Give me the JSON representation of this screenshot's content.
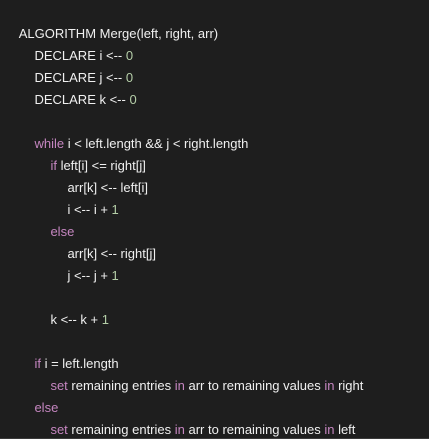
{
  "code": {
    "header": {
      "text": "ALGORITHM Merge(left, right, arr)"
    },
    "decl_i": {
      "kw": "DECLARE i <-- ",
      "val": "0"
    },
    "decl_j": {
      "kw": "DECLARE j <-- ",
      "val": "0"
    },
    "decl_k": {
      "kw": "DECLARE k <-- ",
      "val": "0"
    },
    "while_line": {
      "kw": "while",
      "rest": " i < left.length && j < right.length"
    },
    "if_line": {
      "kw": "if",
      "rest": " left[i] <= right[j]"
    },
    "assign_left": {
      "text": "arr[k] <-- left[i]"
    },
    "inc_i": {
      "text": "i <-- i + ",
      "val": "1"
    },
    "else_line": {
      "kw": "else"
    },
    "assign_right": {
      "text": "arr[k] <-- right[j]"
    },
    "inc_j": {
      "text": "j <-- j + ",
      "val": "1"
    },
    "inc_k": {
      "text": "k <-- k + ",
      "val": "1"
    },
    "if_end": {
      "kw": "if",
      "rest": " i = left.length"
    },
    "set_right": {
      "kw": "set",
      "a": " remaining entries ",
      "in1": "in",
      "b": " arr to remaining values ",
      "in2": "in",
      "c": " right"
    },
    "else_end": {
      "kw": "else"
    },
    "set_left": {
      "kw": "set",
      "a": " remaining entries ",
      "in1": "in",
      "b": " arr to remaining values ",
      "in2": "in",
      "c": " left"
    }
  },
  "colors": {
    "background": "#1e1e1e",
    "text": "#f0f0f0",
    "keyword": "#c586c0",
    "number": "#b5cea8"
  }
}
